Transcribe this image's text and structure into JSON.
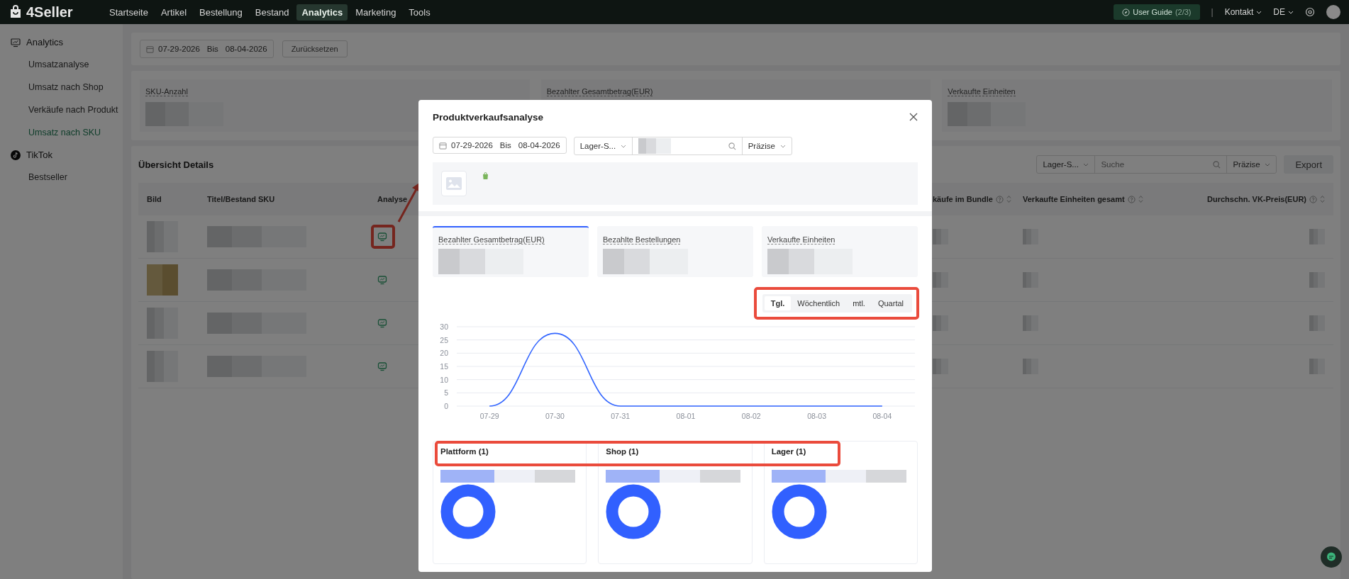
{
  "nav": {
    "logo": "4Seller",
    "items": [
      {
        "label": "Startseite",
        "selected": false
      },
      {
        "label": "Artikel",
        "selected": false
      },
      {
        "label": "Bestellung",
        "selected": false
      },
      {
        "label": "Bestand",
        "selected": false
      },
      {
        "label": "Analytics",
        "selected": true
      },
      {
        "label": "Marketing",
        "selected": false
      },
      {
        "label": "Tools",
        "selected": false
      }
    ],
    "user_guide": "User Guide",
    "user_guide_count": "(2/3)",
    "separator": "|",
    "contact": "Kontakt",
    "language": "DE"
  },
  "sidebar": {
    "groups": [
      {
        "label": "Analytics",
        "kind": "analytics",
        "items": [
          {
            "label": "Umsatzanalyse",
            "selected": false
          },
          {
            "label": "Umsatz nach Shop",
            "selected": false
          },
          {
            "label": "Verkäufe nach Produkt",
            "selected": false
          },
          {
            "label": "Umsatz nach SKU",
            "selected": true
          }
        ]
      },
      {
        "label": "TikTok",
        "kind": "tiktok",
        "items": [
          {
            "label": "Bestseller",
            "selected": false
          }
        ]
      }
    ]
  },
  "filters": {
    "date_from": "07-29-2026",
    "date_sep": "Bis",
    "date_to": "08-04-2026",
    "reset": "Zurücksetzen"
  },
  "stats": [
    {
      "label": "SKU-Anzahl"
    },
    {
      "label": "Bezahlter Gesamtbetrag(EUR)"
    },
    {
      "label": "Verkaufte Einheiten"
    }
  ],
  "details": {
    "title": "Übersicht Details",
    "warehouse_select": "Lager-S...",
    "search_placeholder": "Suche",
    "match_select": "Präzise",
    "export": "Export",
    "columns_left": [
      "Bild",
      "Titel/Bestand SKU",
      "Analyse"
    ],
    "columns_right": [
      {
        "label": "käufe im Bundle"
      },
      {
        "label": "Verkaufte Einheiten gesamt"
      },
      {
        "label": "Durchschn. VK-Preis(EUR)"
      }
    ],
    "rows": [
      {
        "highlighted": true
      },
      {
        "highlighted": false
      },
      {
        "highlighted": false
      },
      {
        "highlighted": false
      }
    ]
  },
  "modal": {
    "title": "Produktverkaufsanalyse",
    "filters": {
      "date_from": "07-29-2026",
      "date_sep": "Bis",
      "date_to": "08-04-2026",
      "warehouse_select": "Lager-S...",
      "match_select": "Präzise"
    },
    "metrics": [
      {
        "label": "Bezahlter Gesamtbetrag(EUR)",
        "selected": true
      },
      {
        "label": "Bezahlte Bestellungen",
        "selected": false
      },
      {
        "label": "Verkaufte Einheiten",
        "selected": false
      }
    ],
    "periods": {
      "highlighted": true,
      "items": [
        {
          "label": "Tgl.",
          "selected": true
        },
        {
          "label": "Wöchentlich",
          "selected": false
        },
        {
          "label": "mtl.",
          "selected": false
        },
        {
          "label": "Quartal",
          "selected": false
        }
      ]
    },
    "chart_data": {
      "type": "line",
      "categories": [
        "07-29",
        "07-30",
        "07-31",
        "08-01",
        "08-02",
        "08-03",
        "08-04"
      ],
      "series": [
        {
          "color": "#3366ff",
          "values": [
            0,
            27.5,
            0,
            0,
            0,
            0,
            0
          ]
        }
      ],
      "ylim": [
        0,
        30
      ],
      "yticks": [
        0,
        5,
        10,
        15,
        20,
        25,
        30
      ],
      "grid": true
    },
    "breakdowns": {
      "highlighted": true,
      "items": [
        {
          "label": "Plattform (1)"
        },
        {
          "label": "Shop (1)"
        },
        {
          "label": "Lager (1)"
        }
      ]
    }
  }
}
